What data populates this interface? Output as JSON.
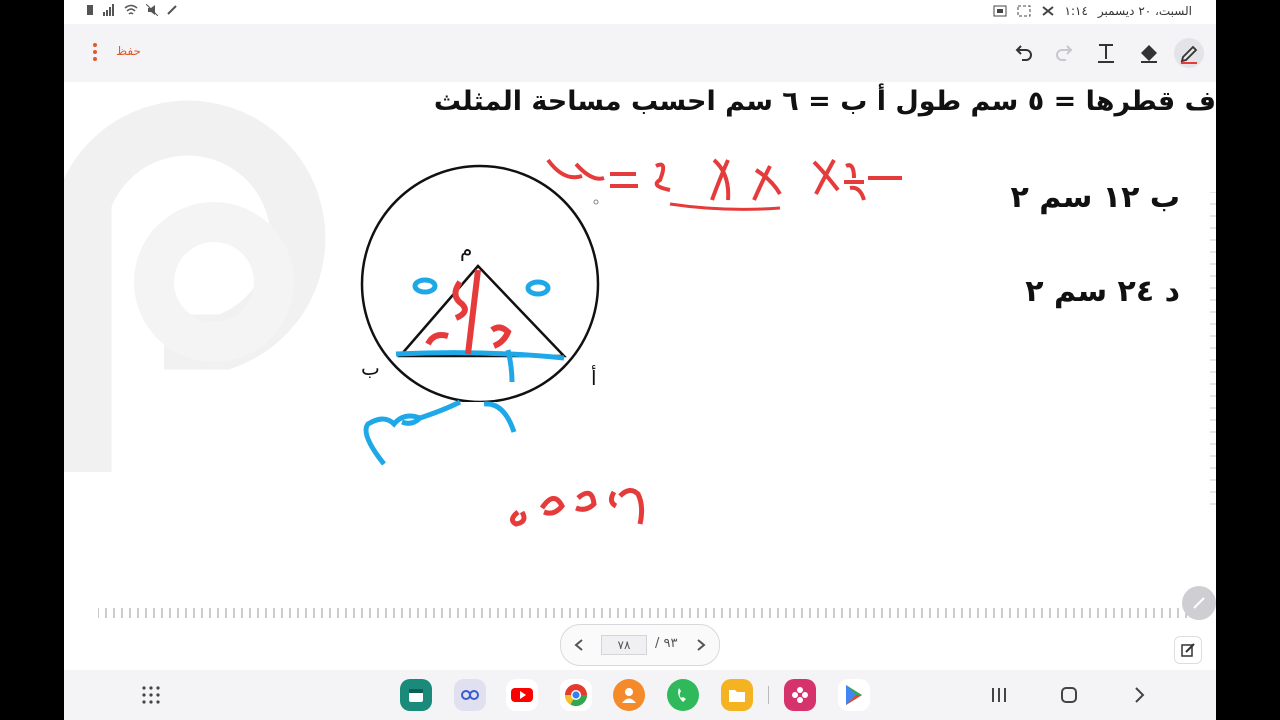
{
  "status_bar": {
    "datetime": "السبت، ٢٠ ديسمبر",
    "time": "١:١٤"
  },
  "toolbar": {
    "save_label": "حفظ",
    "tools": [
      "pen-icon",
      "eraser-icon",
      "text-icon",
      "redo-icon",
      "undo-icon"
    ]
  },
  "slide": {
    "question": "ف قطرها = ٥ سم  طول أ ب = ٦ سم احسب مساحة المثلث",
    "option_b": "ب ١٢ سم ٢",
    "option_d": "د ٢٤ سم ٢",
    "label_m": "م",
    "label_b": "ب",
    "label_a": "أ"
  },
  "annotations": {
    "formula": "١٢ = ٤ × ٦ × ½",
    "radius_left": "٥",
    "radius_right": "٥",
    "height": "٤",
    "half_base": "٣",
    "base": "٦ سم",
    "triple": "٥،٤،٣"
  },
  "pager": {
    "current": "٧٨",
    "total": "/ ٩٣"
  },
  "dock": {
    "apps": [
      "calendar-icon",
      "chat-icon",
      "youtube-icon",
      "chrome-icon",
      "contacts-icon",
      "phone-icon",
      "files-icon",
      "gallery-icon",
      "play-store-icon"
    ]
  },
  "colors": {
    "accent": "#e05a2b",
    "ink_red": "#e53b3b",
    "ink_blue": "#1ea8e8"
  }
}
